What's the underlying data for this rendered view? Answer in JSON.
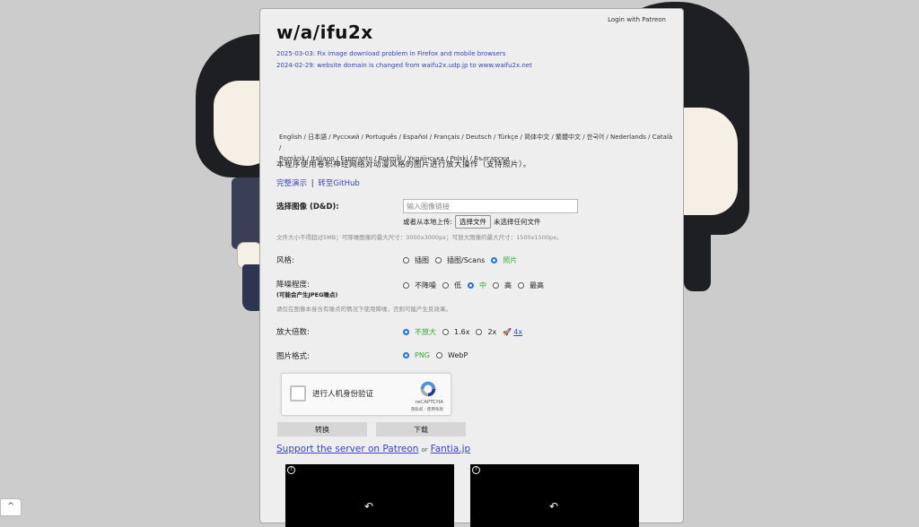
{
  "header": {
    "logo": "w/a/ifu2x",
    "login_label": "Login with Patreon"
  },
  "news": [
    "2025-03-03: Fix image download problem in Firefox and mobile browsers",
    "2024-02-29: website domain is changed from waifu2x.udp.jp to www.waifu2x.net"
  ],
  "languages": {
    "line1": "English / 日本語 / Русский / Português / Español / Français / Deutsch / Türkçe / 简体中文 / 繁體中文 / 한국어 / Nederlands / Català /",
    "line2": "Română / Italiano / Esperanto / Bokmål / Українська / Polski / Български"
  },
  "description": "本程序使用卷积神经网络对动漫风格的图片进行放大操作（支持照片）。",
  "links": {
    "demo": "完整演示",
    "separator": "|",
    "github": "转至GitHub"
  },
  "image_input": {
    "label": "选择图像 (D&D):",
    "url_placeholder": "输入图像链接",
    "local_label": "或者从本地上传:",
    "choose_file": "选择文件",
    "no_file": "未选择任何文件",
    "limit_hint": "文件大小不得超过5MB；可降噪图像的最大尺寸：3000x3000px；可放大图像的最大尺寸：1500x1500px。"
  },
  "style": {
    "label": "风格:",
    "options": [
      "插图",
      "插图/Scans",
      "照片"
    ],
    "selected_index": 2
  },
  "noise": {
    "label": "降噪程度:",
    "sublabel": "(可能会产生JPEG噪点)",
    "options": [
      "不降噪",
      "低",
      "中",
      "高",
      "最高"
    ],
    "selected_index": 2,
    "hint": "请仅在图像本身含有噪点的情况下使用降噪，否则可能产生反效果。"
  },
  "scale": {
    "label": "放大倍数:",
    "options": [
      "不放大",
      "1.6x",
      "2x",
      "4x"
    ],
    "selected_index": 0
  },
  "format": {
    "label": "图片格式:",
    "options": [
      "PNG",
      "WebP"
    ],
    "selected_index": 0
  },
  "captcha": {
    "text": "进行人机身份验证",
    "brand": "reCAPTCHA",
    "terms": "隐私权 - 使用条款"
  },
  "buttons": {
    "convert": "转换",
    "download": "下载"
  },
  "support": {
    "patreon": "Support the server on Patreon",
    "or": "or",
    "fantia": "Fantia.jp"
  },
  "colors": {
    "accent_link": "#3645c9",
    "selected_option": "#3aa839",
    "radio_on": "#1a73e8"
  }
}
